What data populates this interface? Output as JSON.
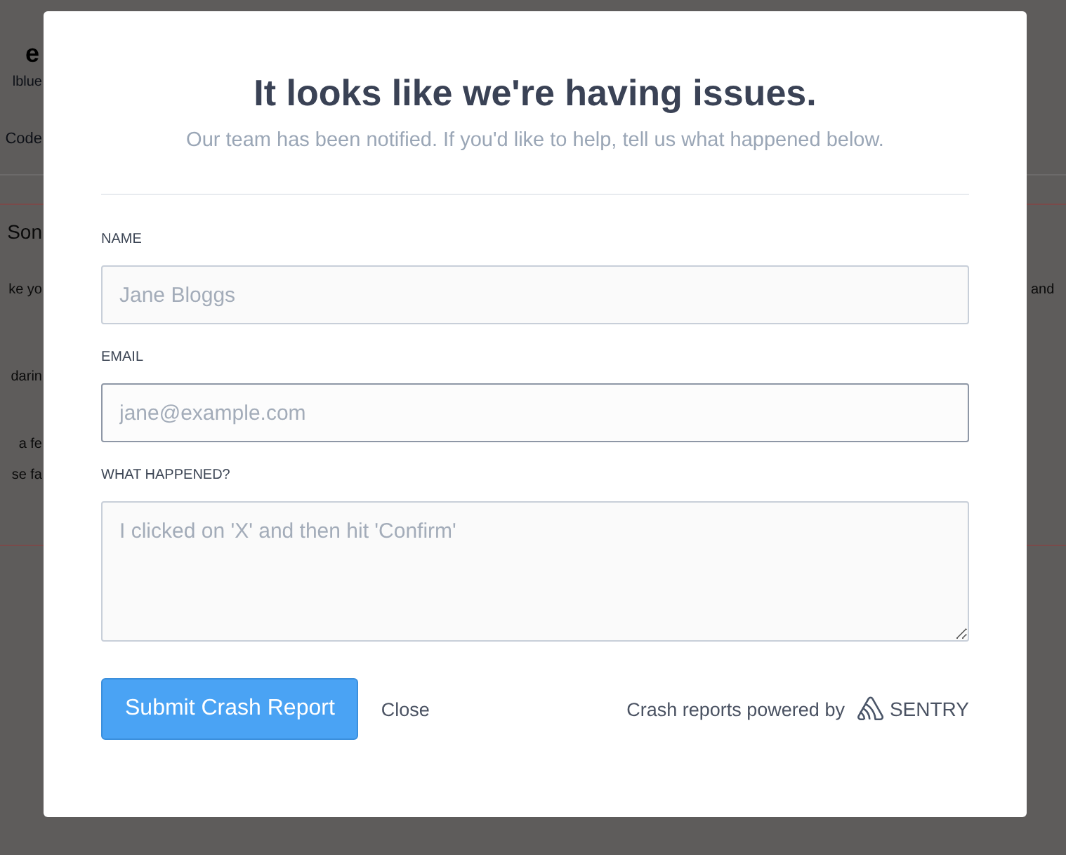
{
  "background_page": {
    "left_fragments": [
      {
        "text": "e",
        "kind": "title"
      },
      {
        "text": "lblue",
        "kind": "sub"
      },
      {
        "text": "Code",
        "kind": "tab"
      },
      {
        "text": "Son",
        "kind": "heading"
      },
      {
        "text": "ke yo",
        "kind": "body"
      },
      {
        "text": "darin",
        "kind": "body"
      },
      {
        "text": "a fe",
        "kind": "body"
      },
      {
        "text": "se fa",
        "kind": "body"
      }
    ],
    "right_fragments": [
      {
        "text": "and"
      }
    ]
  },
  "dialog": {
    "title": "It looks like we're having issues.",
    "subtitle": "Our team has been notified. If you'd like to help, tell us what happened below.",
    "fields": [
      {
        "label": "NAME",
        "placeholder": "Jane Bloggs",
        "kind": "input",
        "focused": false
      },
      {
        "label": "EMAIL",
        "placeholder": "jane@example.com",
        "kind": "input",
        "focused": true
      },
      {
        "label": "WHAT HAPPENED?",
        "placeholder": "I clicked on 'X' and then hit 'Confirm'",
        "kind": "textarea",
        "focused": false
      }
    ],
    "submit_button": "Submit Crash Report",
    "close_link": "Close",
    "powered_by": "Crash reports powered by",
    "brand": "SENTRY"
  }
}
